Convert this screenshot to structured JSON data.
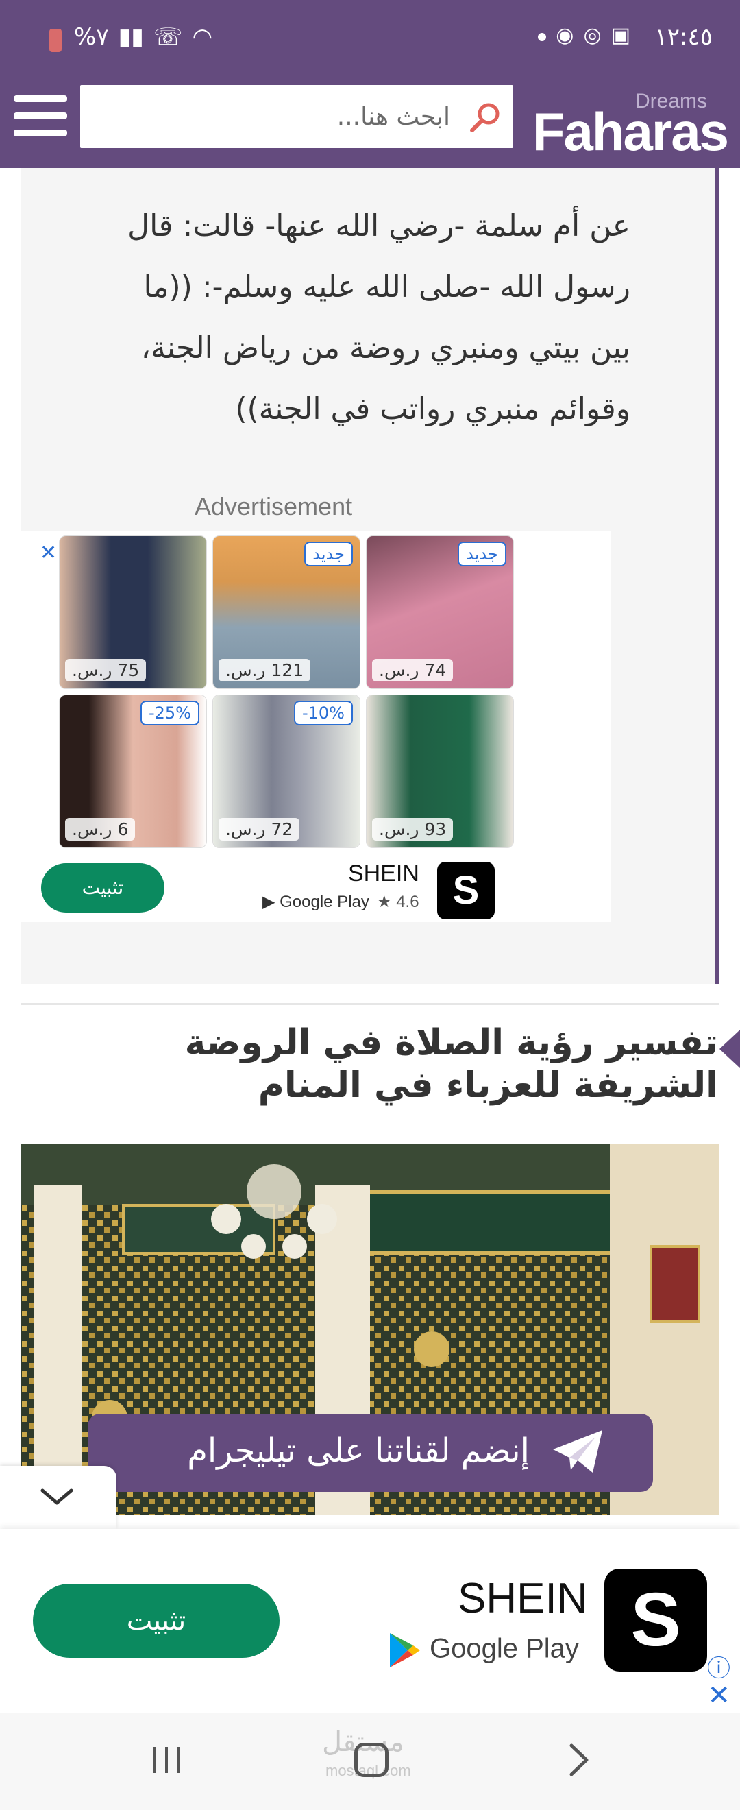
{
  "status_bar": {
    "time": "١٢:٤٥",
    "battery_percent": "%٧"
  },
  "header": {
    "logo_text": "Faharas",
    "logo_subtext": "Dreams",
    "search_placeholder": "ابحث هنا..."
  },
  "article": {
    "quote_text": "عن أم سلمة -رضي الله عنها- قالت: قال رسول الله -صلى الله عليه وسلم-: ((ما بين بيتي ومنبري روضة من رياض الجنة، وقوائم منبري رواتب في الجنة))",
    "ad_label": "Advertisement"
  },
  "inline_ad": {
    "brand": "SHEIN",
    "store": "Google Play",
    "rating": "4.6",
    "install_label": "تثبيت",
    "products": [
      {
        "price": "74 ر.س.",
        "badge": "جديد"
      },
      {
        "price": "121 ر.س.",
        "badge": "جديد"
      },
      {
        "price": "75 ر.س.",
        "badge": ""
      },
      {
        "price": "93 ر.س.",
        "badge": ""
      },
      {
        "price": "72 ر.س.",
        "badge": "-10%"
      },
      {
        "price": "6 ر.س.",
        "badge": "-25%"
      }
    ]
  },
  "section": {
    "title": "تفسير رؤية الصلاة في الروضة الشريفة للعزباء في المنام"
  },
  "telegram": {
    "label": "إنضم لقناتنا على تيليجرام"
  },
  "bottom_ad": {
    "brand": "SHEIN",
    "store": "Google Play",
    "install_label": "تثبيت",
    "logo_letter": "S"
  },
  "watermark": {
    "main": "مستقل",
    "sub": "mostaql.com"
  },
  "colors": {
    "brand_purple": "#644b7e",
    "install_green": "#0b8a5f",
    "ad_blue": "#2b6fd4"
  }
}
